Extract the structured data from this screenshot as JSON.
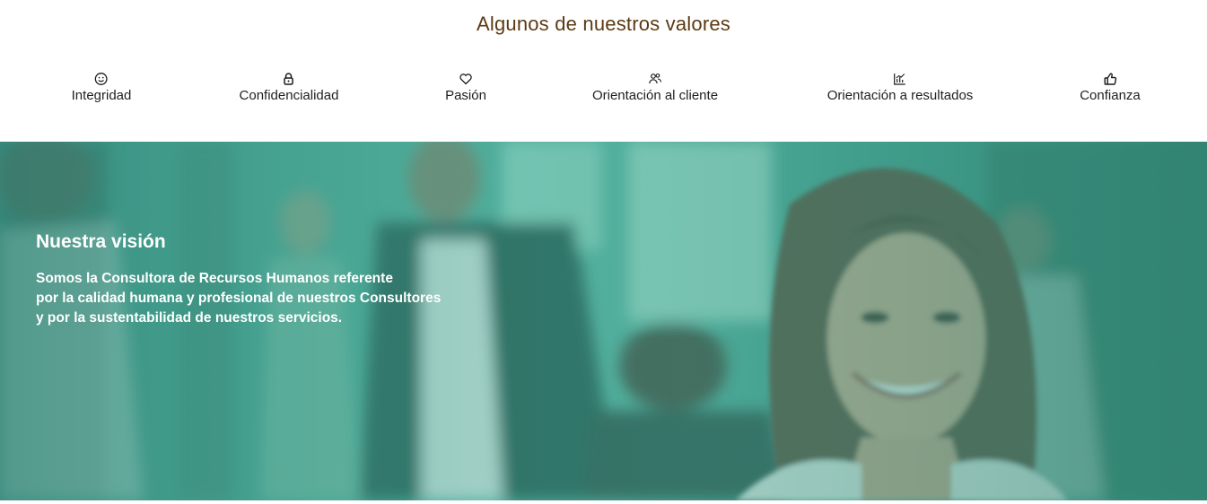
{
  "values": {
    "title": "Algunos de nuestros valores",
    "accent_color": "#5c3a12",
    "items": [
      {
        "label": "Integridad",
        "icon": "smile-icon"
      },
      {
        "label": "Confidencialidad",
        "icon": "lock-icon"
      },
      {
        "label": "Pasión",
        "icon": "heart-icon"
      },
      {
        "label": "Orientación al cliente",
        "icon": "users-icon"
      },
      {
        "label": "Orientación a resultados",
        "icon": "chart-icon"
      },
      {
        "label": "Confianza",
        "icon": "thumbs-up-icon"
      }
    ]
  },
  "vision": {
    "heading": "Nuestra visión",
    "lines": [
      "Somos la Consultora de Recursos Humanos referente",
      "por la calidad humana y profesional de nuestros Consultores",
      "y por la sustentabilidad de nuestros servicios."
    ],
    "overlay_color": "#4aa796"
  }
}
